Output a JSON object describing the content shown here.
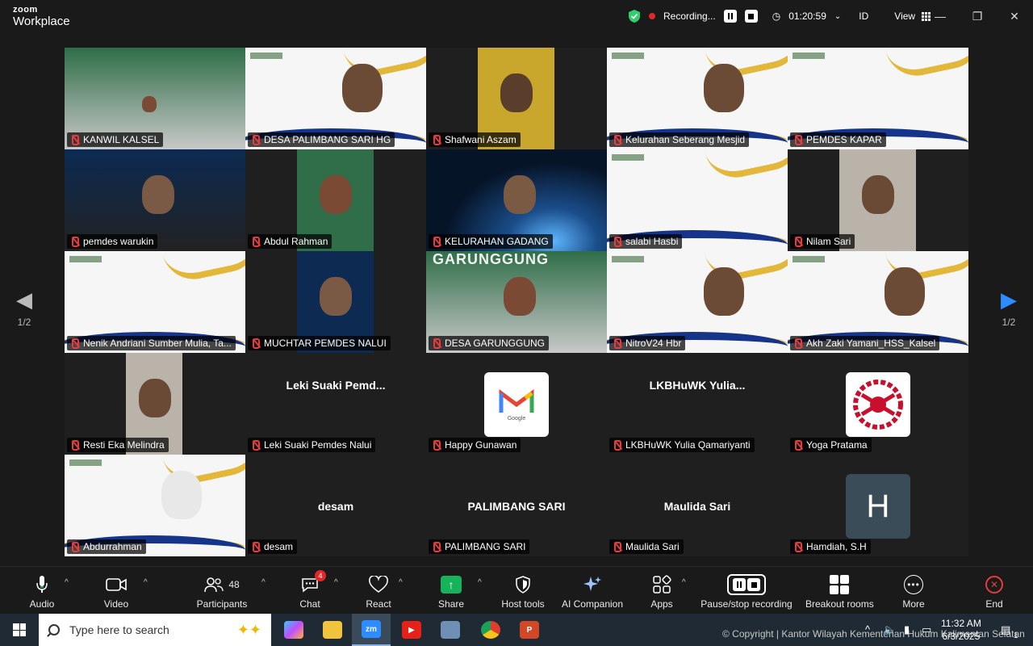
{
  "app": {
    "brand_top": "zoom",
    "brand_bottom": "Workplace"
  },
  "titlebar": {
    "recording_label": "Recording...",
    "timer": "01:20:59",
    "id_label": "ID",
    "view_label": "View"
  },
  "gallery": {
    "page_prev": "1/2",
    "page_next": "1/2",
    "tiles": [
      {
        "name": "KANWIL KALSEL",
        "kind": "video",
        "active": true
      },
      {
        "name": "DESA PALIMBANG SARI HG",
        "kind": "banner"
      },
      {
        "name": "Shafwani Aszam",
        "kind": "video"
      },
      {
        "name": "Kelurahan Seberang Mesjid",
        "kind": "banner"
      },
      {
        "name": "PEMDES KAPAR",
        "kind": "banner"
      },
      {
        "name": "pemdes warukin",
        "kind": "video"
      },
      {
        "name": "Abdul Rahman",
        "kind": "video"
      },
      {
        "name": "KELURAHAN GADANG",
        "kind": "video"
      },
      {
        "name": "salabi Hasbi",
        "kind": "banner"
      },
      {
        "name": "Nilam Sari",
        "kind": "video"
      },
      {
        "name": "Nenik Andriani Sumber Mulia, Ta...",
        "kind": "banner"
      },
      {
        "name": "MUCHTAR PEMDES NALUI",
        "kind": "video"
      },
      {
        "name": "DESA GARUNGGUNG",
        "kind": "video",
        "overlay_text": "GARUNGGUNG"
      },
      {
        "name": "NitroV24 Hbr",
        "kind": "banner"
      },
      {
        "name": "Akh Zaki Yamani_HSS_Kalsel",
        "kind": "banner"
      },
      {
        "name": "Resti Eka Melindra",
        "kind": "video"
      },
      {
        "name": "Leki Suaki Pemdes Nalui",
        "kind": "text",
        "display": "Leki  Suaki  Pemd..."
      },
      {
        "name": "Happy Gunawan",
        "kind": "gmail",
        "logo_text": "Google"
      },
      {
        "name": "LKBHuWK Yulia Qamariyanti",
        "kind": "text",
        "display": "LKBHuWK  Yulia..."
      },
      {
        "name": "Yoga Pratama",
        "kind": "logo"
      },
      {
        "name": "Abdurrahman",
        "kind": "banner"
      },
      {
        "name": "desam",
        "kind": "text",
        "display": "desam"
      },
      {
        "name": "PALIMBANG SARI",
        "kind": "text",
        "display": "PALIMBANG SARI"
      },
      {
        "name": "Maulida Sari",
        "kind": "text",
        "display": "Maulida Sari"
      },
      {
        "name": "Hamdiah, S.H",
        "kind": "avatar",
        "initial": "H"
      }
    ]
  },
  "toolbar": {
    "audio": "Audio",
    "video": "Video",
    "participants": "Participants",
    "participants_count": "48",
    "chat": "Chat",
    "chat_badge": "4",
    "react": "React",
    "share": "Share",
    "host_tools": "Host tools",
    "ai_companion": "AI Companion",
    "apps": "Apps",
    "pause_stop": "Pause/stop recording",
    "breakout": "Breakout rooms",
    "more": "More",
    "end": "End"
  },
  "taskbar": {
    "search_placeholder": "Type here to search",
    "copyright": "© Copyright | Kantor Wilayah Kementerian Hukum Kalimantan Selatan",
    "time": "11:32 AM",
    "date": "6/3/2025",
    "notification_count": "1"
  },
  "colors": {
    "active_border": "#2ed06e",
    "share_green": "#17b35b",
    "end_red": "#e53d3d",
    "muted_red": "#e53d3d"
  }
}
